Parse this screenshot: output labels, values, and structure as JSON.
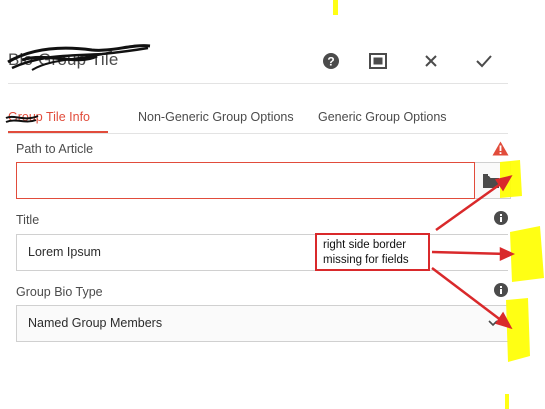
{
  "dialog": {
    "title": "Bio Group Tile",
    "header_icons": [
      "help-icon",
      "fullscreen-icon",
      "close-icon",
      "done-icon"
    ]
  },
  "tabs": [
    {
      "label": "Group Tile Info",
      "active": true
    },
    {
      "label": "Non-Generic Group Options",
      "active": false
    },
    {
      "label": "Generic Group Options",
      "active": false
    }
  ],
  "fields": {
    "path": {
      "label": "Path to Article",
      "value": "",
      "state": "invalid"
    },
    "title": {
      "label": "Title",
      "value": "Lorem Ipsum"
    },
    "bio_type": {
      "label": "Group Bio Type",
      "value": "Named Group Members"
    }
  },
  "annotation": {
    "text_line1": "right side border",
    "text_line2": "missing for fields",
    "color": "#d9292b",
    "highlight_color": "#ffff00"
  },
  "colors": {
    "accent": "#e14c3b",
    "text": "#4b4b4b",
    "icon": "#4b4b4b"
  }
}
